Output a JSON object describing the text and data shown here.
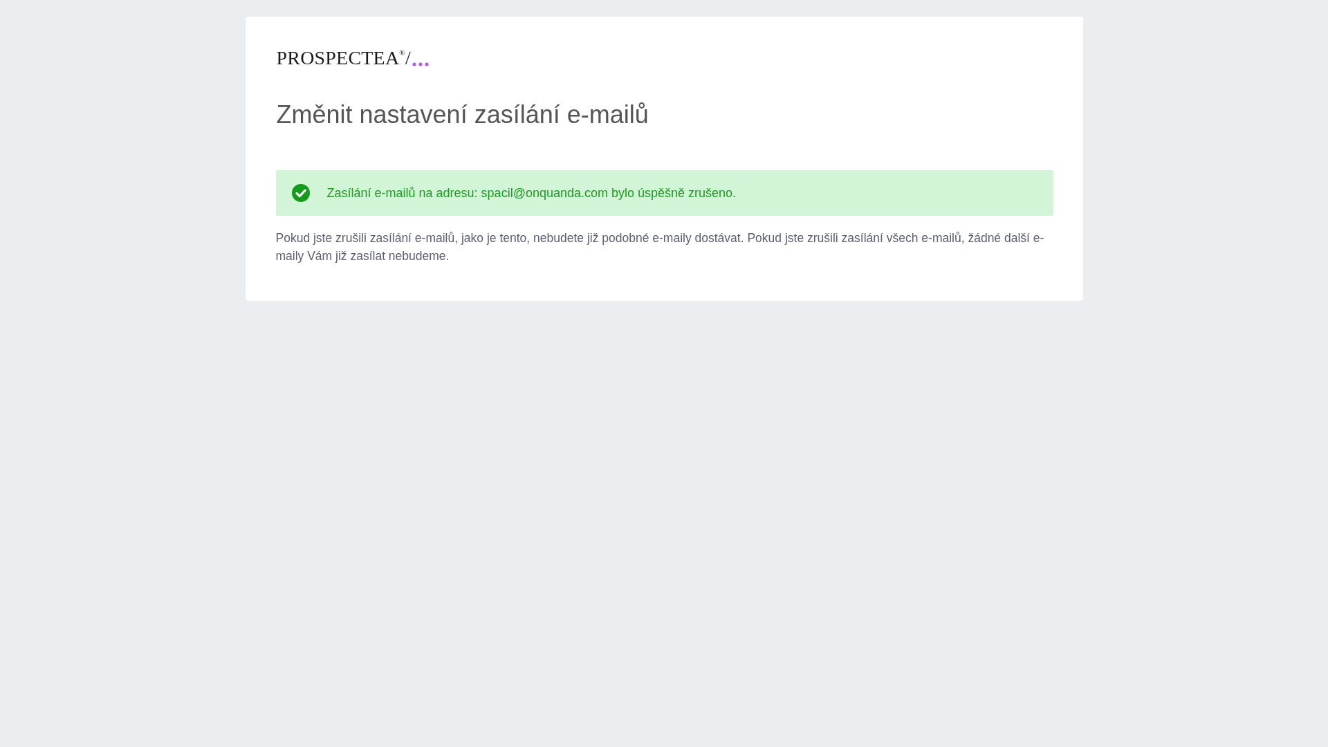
{
  "logo": {
    "text": "PROSPECTEA$^{®}$/"
  },
  "title": "Změnit nastavení zasílání e-mailů",
  "alert": {
    "message": "Zasílání e-mailů na adresu: spacil@onquanda.com bylo úspěšně zrušeno."
  },
  "info_text": "Pokud jste zrušili zasílání e-mailů, jako je tento, nebudete již podobné e-maily dostávat. Pokud jste zrušili zasílání všech e-mailů, žádné další e-maily Vám již zasílat nebudeme."
}
